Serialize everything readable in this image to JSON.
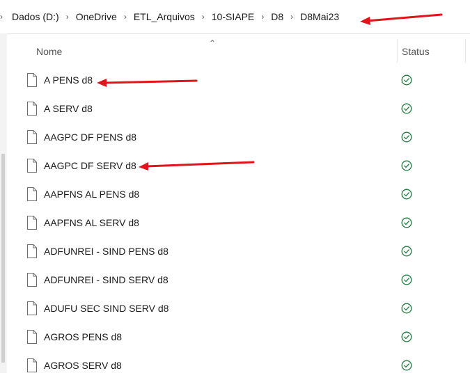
{
  "breadcrumb": {
    "items": [
      "Dados (D:)",
      "OneDrive",
      "ETL_Arquivos",
      "10-SIAPE",
      "D8",
      "D8Mai23"
    ]
  },
  "header": {
    "name": "Nome",
    "status": "Status"
  },
  "files": [
    {
      "name": "A PENS d8"
    },
    {
      "name": "A SERV d8"
    },
    {
      "name": "AAGPC DF PENS d8"
    },
    {
      "name": "AAGPC DF SERV d8"
    },
    {
      "name": "AAPFNS AL PENS d8"
    },
    {
      "name": "AAPFNS AL SERV d8"
    },
    {
      "name": "ADFUNREI - SIND PENS d8"
    },
    {
      "name": "ADFUNREI - SIND SERV d8"
    },
    {
      "name": "ADUFU SEC SIND SERV d8"
    },
    {
      "name": "AGROS PENS d8"
    },
    {
      "name": "AGROS SERV d8"
    }
  ],
  "status_icon": "synced-check-icon",
  "colors": {
    "status": "#1e7b3c",
    "annotation": "#e0141a"
  }
}
